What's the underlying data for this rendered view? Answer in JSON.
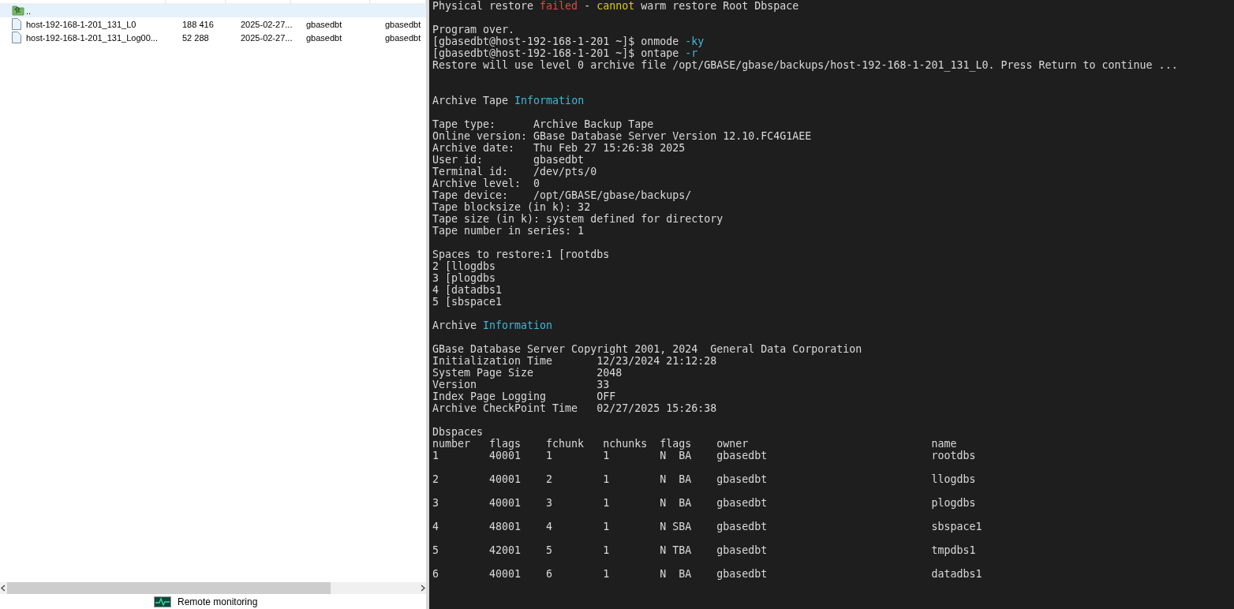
{
  "file_list": {
    "rows": [
      {
        "kind": "parent",
        "name": "..",
        "selected": true
      },
      {
        "kind": "file",
        "name": "host-192-168-1-201_131_L0",
        "size": "188 416",
        "modified": "2025-02-27...",
        "owner": "gbasedbt",
        "group": "gbasedbt",
        "selected": false
      },
      {
        "kind": "file",
        "name": "host-192-168-1-201_131_Log00...",
        "size": "52 288",
        "modified": "2025-02-27...",
        "owner": "gbasedbt",
        "group": "gbasedbt",
        "selected": false
      }
    ]
  },
  "bottom_bar": {
    "label": "Remote monitoring"
  },
  "terminal": {
    "lines": [
      {
        "kind": "text",
        "segments": [
          {
            "kind": "plain",
            "text": "Physical restore "
          },
          {
            "kind": "error",
            "text": "failed"
          },
          {
            "kind": "plain",
            "text": " - "
          },
          {
            "kind": "warn",
            "text": "cannot"
          },
          {
            "kind": "plain",
            "text": " warm restore Root Dbspace"
          }
        ]
      },
      {
        "kind": "blank"
      },
      {
        "kind": "text",
        "segments": [
          {
            "kind": "plain",
            "text": "Program over."
          }
        ]
      },
      {
        "kind": "text",
        "segments": [
          {
            "kind": "plain",
            "text": "[gbasedbt@host-192-168-1-201 ~]$ onmode "
          },
          {
            "kind": "option",
            "text": "-ky"
          }
        ]
      },
      {
        "kind": "text",
        "segments": [
          {
            "kind": "plain",
            "text": "[gbasedbt@host-192-168-1-201 ~]$ ontape "
          },
          {
            "kind": "option",
            "text": "-r"
          }
        ]
      },
      {
        "kind": "text",
        "segments": [
          {
            "kind": "plain",
            "text": "Restore will use level 0 archive file /opt/GBASE/gbase/backups/host-192-168-1-201_131_L0. Press Return to continue ..."
          }
        ]
      },
      {
        "kind": "blank"
      },
      {
        "kind": "blank"
      },
      {
        "kind": "text",
        "segments": [
          {
            "kind": "plain",
            "text": "Archive Tape "
          },
          {
            "kind": "option",
            "text": "Information"
          }
        ]
      },
      {
        "kind": "blank"
      },
      {
        "kind": "text",
        "segments": [
          {
            "kind": "plain",
            "text": "Tape type:      Archive Backup Tape"
          }
        ]
      },
      {
        "kind": "text",
        "segments": [
          {
            "kind": "plain",
            "text": "Online version: GBase Database Server Version 12.10.FC4G1AEE"
          }
        ]
      },
      {
        "kind": "text",
        "segments": [
          {
            "kind": "plain",
            "text": "Archive date:   Thu Feb 27 15:26:38 2025"
          }
        ]
      },
      {
        "kind": "text",
        "segments": [
          {
            "kind": "plain",
            "text": "User id:        gbasedbt"
          }
        ]
      },
      {
        "kind": "text",
        "segments": [
          {
            "kind": "plain",
            "text": "Terminal id:    /dev/pts/0"
          }
        ]
      },
      {
        "kind": "text",
        "segments": [
          {
            "kind": "plain",
            "text": "Archive level:  0"
          }
        ]
      },
      {
        "kind": "text",
        "segments": [
          {
            "kind": "plain",
            "text": "Tape device:    /opt/GBASE/gbase/backups/"
          }
        ]
      },
      {
        "kind": "text",
        "segments": [
          {
            "kind": "plain",
            "text": "Tape blocksize (in k): 32"
          }
        ]
      },
      {
        "kind": "text",
        "segments": [
          {
            "kind": "plain",
            "text": "Tape size (in k): system defined for directory"
          }
        ]
      },
      {
        "kind": "text",
        "segments": [
          {
            "kind": "plain",
            "text": "Tape number in series: 1"
          }
        ]
      },
      {
        "kind": "blank"
      },
      {
        "kind": "text",
        "segments": [
          {
            "kind": "plain",
            "text": "Spaces to restore:1 [rootdbs"
          }
        ]
      },
      {
        "kind": "text",
        "segments": [
          {
            "kind": "plain",
            "text": "2 [llogdbs"
          }
        ]
      },
      {
        "kind": "text",
        "segments": [
          {
            "kind": "plain",
            "text": "3 [plogdbs"
          }
        ]
      },
      {
        "kind": "text",
        "segments": [
          {
            "kind": "plain",
            "text": "4 [datadbs1"
          }
        ]
      },
      {
        "kind": "text",
        "segments": [
          {
            "kind": "plain",
            "text": "5 [sbspace1"
          }
        ]
      },
      {
        "kind": "blank"
      },
      {
        "kind": "text",
        "segments": [
          {
            "kind": "plain",
            "text": "Archive "
          },
          {
            "kind": "option",
            "text": "Information"
          }
        ]
      },
      {
        "kind": "blank"
      },
      {
        "kind": "text",
        "segments": [
          {
            "kind": "plain",
            "text": "GBase Database Server Copyright 2001, 2024  General Data Corporation"
          }
        ]
      },
      {
        "kind": "text",
        "segments": [
          {
            "kind": "plain",
            "text": "Initialization Time       12/23/2024 21:12:28"
          }
        ]
      },
      {
        "kind": "text",
        "segments": [
          {
            "kind": "plain",
            "text": "System Page Size          2048"
          }
        ]
      },
      {
        "kind": "text",
        "segments": [
          {
            "kind": "plain",
            "text": "Version                   33"
          }
        ]
      },
      {
        "kind": "text",
        "segments": [
          {
            "kind": "plain",
            "text": "Index Page Logging        OFF"
          }
        ]
      },
      {
        "kind": "text",
        "segments": [
          {
            "kind": "plain",
            "text": "Archive CheckPoint Time   02/27/2025 15:26:38"
          }
        ]
      },
      {
        "kind": "blank"
      },
      {
        "kind": "text",
        "segments": [
          {
            "kind": "plain",
            "text": "Dbspaces"
          }
        ]
      },
      {
        "kind": "text",
        "segments": [
          {
            "kind": "plain",
            "text": "number   flags    fchunk   nchunks  flags    owner                             name"
          }
        ]
      },
      {
        "kind": "text",
        "segments": [
          {
            "kind": "plain",
            "text": "1        40001    1        1        N  BA    gbasedbt                          rootdbs"
          }
        ]
      },
      {
        "kind": "blank"
      },
      {
        "kind": "text",
        "segments": [
          {
            "kind": "plain",
            "text": "2        40001    2        1        N  BA    gbasedbt                          llogdbs"
          }
        ]
      },
      {
        "kind": "blank"
      },
      {
        "kind": "text",
        "segments": [
          {
            "kind": "plain",
            "text": "3        40001    3        1        N  BA    gbasedbt                          plogdbs"
          }
        ]
      },
      {
        "kind": "blank"
      },
      {
        "kind": "text",
        "segments": [
          {
            "kind": "plain",
            "text": "4        48001    4        1        N SBA    gbasedbt                          sbspace1"
          }
        ]
      },
      {
        "kind": "blank"
      },
      {
        "kind": "text",
        "segments": [
          {
            "kind": "plain",
            "text": "5        42001    5        1        N TBA    gbasedbt                          tmpdbs1"
          }
        ]
      },
      {
        "kind": "blank"
      },
      {
        "kind": "text",
        "segments": [
          {
            "kind": "plain",
            "text": "6        40001    6        1        N  BA    gbasedbt                          datadbs1"
          }
        ]
      }
    ]
  }
}
